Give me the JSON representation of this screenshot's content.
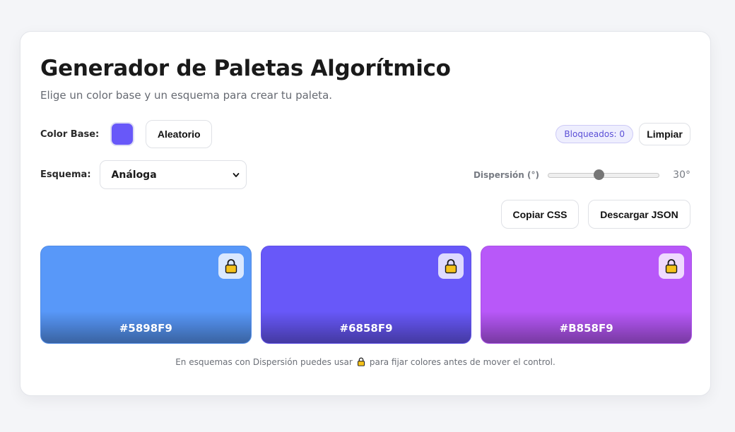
{
  "header": {
    "title": "Generador de Paletas Algorítmico",
    "subtitle": "Elige un color base y un esquema para crear tu paleta."
  },
  "controls": {
    "base_color_label": "Color Base:",
    "base_color": "#6858F9",
    "random_button": "Aleatorio",
    "locked_badge": "Bloqueados: 0",
    "clear_button": "Limpiar",
    "scheme_label": "Esquema:",
    "scheme_selected": "Análoga",
    "dispersion_label": "Dispersión (°)",
    "dispersion_value_text": "30°",
    "dispersion_fraction": 0.46,
    "copy_css_button": "Copiar CSS",
    "download_json_button": "Descargar JSON"
  },
  "palette": [
    {
      "hex": "#5898F9",
      "color": "#5898F9",
      "locked": false,
      "lock_icon": "lock-icon"
    },
    {
      "hex": "#6858F9",
      "color": "#6858F9",
      "locked": false,
      "lock_icon": "lock-icon"
    },
    {
      "hex": "#B858F9",
      "color": "#B858F9",
      "locked": false,
      "lock_icon": "lock-icon"
    }
  ],
  "footnote": {
    "before": "En esquemas con Dispersión puedes usar",
    "after": "para fijar colores antes de mover el control."
  }
}
